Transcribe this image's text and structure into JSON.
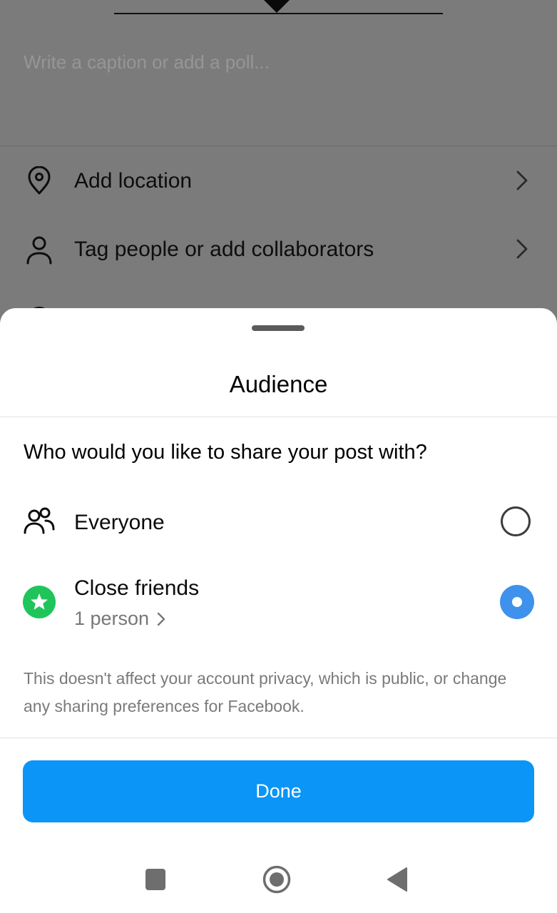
{
  "background": {
    "caption_placeholder": "Write a caption or add a poll...",
    "rows": [
      {
        "label": "Add location",
        "icon": "location-pin-icon"
      },
      {
        "label": "Tag people or add collaborators",
        "icon": "person-icon"
      },
      {
        "label": "",
        "icon": "refresh-icon"
      }
    ]
  },
  "sheet": {
    "title": "Audience",
    "question": "Who would you like to share your post with?",
    "options": [
      {
        "label": "Everyone",
        "icon": "people-icon",
        "selected": false
      },
      {
        "label": "Close friends",
        "sublabel": "1 person",
        "icon": "star-badge-icon",
        "selected": true
      }
    ],
    "disclaimer": "This doesn't affect your account privacy, which is public, or change any sharing preferences for Facebook.",
    "done_label": "Done"
  },
  "colors": {
    "accent": "#0a95f7",
    "radio_selected": "#3e92ec",
    "close_friends_green": "#1fc55a",
    "scrim": "#7b7b7b"
  },
  "navbar": {
    "icons": [
      "recents-square-icon",
      "home-circle-icon",
      "back-triangle-icon"
    ]
  }
}
